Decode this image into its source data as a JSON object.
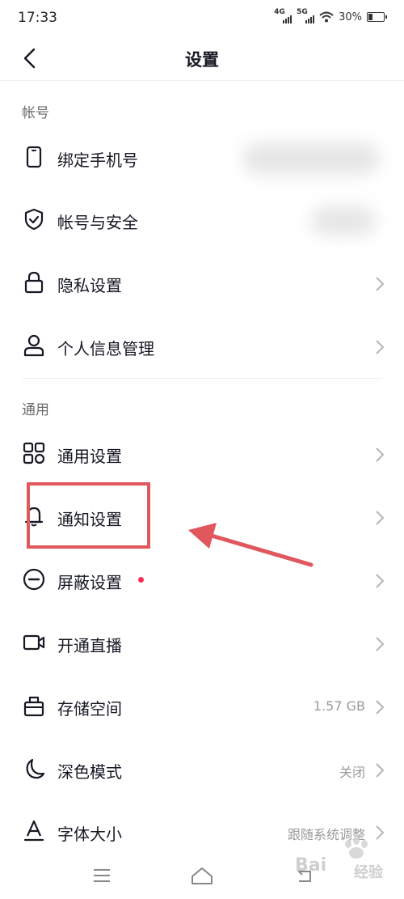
{
  "status_bar": {
    "time": "17:33",
    "network_1": "4G",
    "network_2": "5G",
    "battery_percent": "30%",
    "battery_level": 0.3
  },
  "header": {
    "title": "设置"
  },
  "sections": {
    "account": {
      "title": "帐号",
      "items": [
        {
          "label": "绑定手机号",
          "icon": "phone-icon"
        },
        {
          "label": "帐号与安全",
          "icon": "shield-icon"
        },
        {
          "label": "隐私设置",
          "icon": "lock-icon"
        },
        {
          "label": "个人信息管理",
          "icon": "user-icon"
        }
      ]
    },
    "general": {
      "title": "通用",
      "items": [
        {
          "label": "通用设置",
          "icon": "grid-icon"
        },
        {
          "label": "通知设置",
          "icon": "bell-icon"
        },
        {
          "label": "屏蔽设置",
          "icon": "block-icon"
        },
        {
          "label": "开通直播",
          "icon": "video-icon"
        },
        {
          "label": "存储空间",
          "icon": "storage-icon",
          "value": "1.57 GB"
        },
        {
          "label": "深色模式",
          "icon": "moon-icon",
          "value": "关闭"
        },
        {
          "label": "字体大小",
          "icon": "font-icon",
          "value": "跟随系统调整"
        }
      ]
    }
  },
  "watermark": {
    "text": "经验"
  },
  "colors": {
    "accent_dot": "#fe2c55",
    "annotation": "#e0575e",
    "text": "#161823",
    "secondary": "#9a9a9a"
  }
}
